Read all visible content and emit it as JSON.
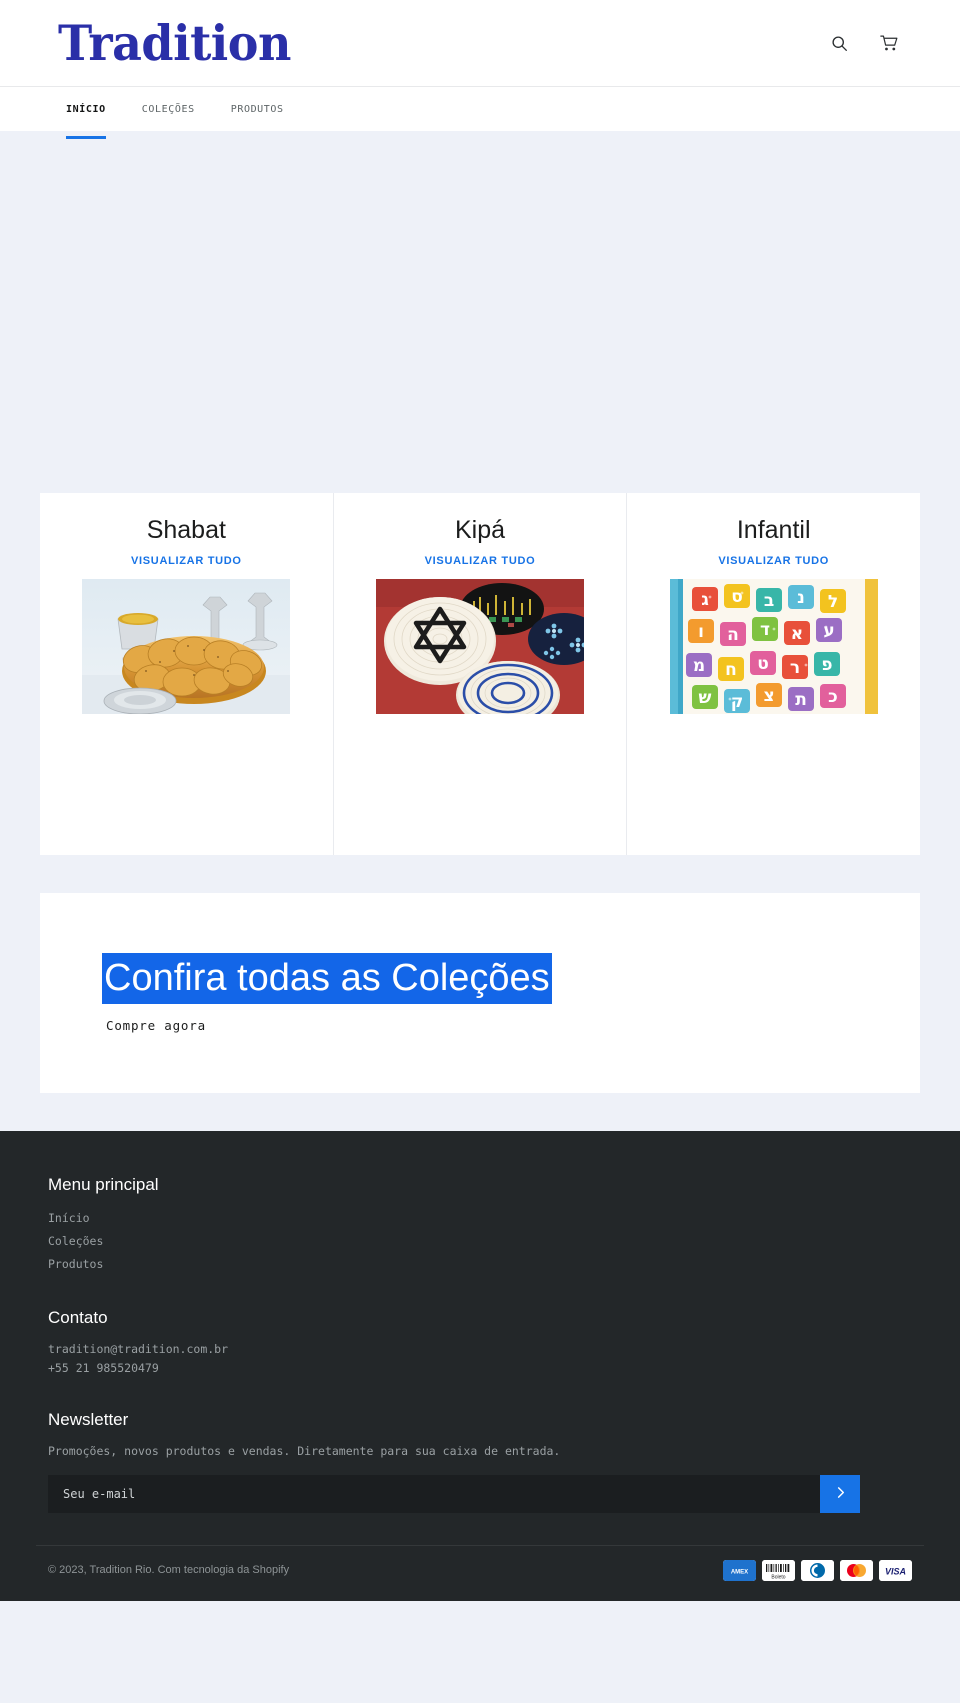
{
  "site": {
    "logo_text": "Tradition"
  },
  "header": {
    "search_icon": "search-icon",
    "cart_icon": "shopping-cart-icon"
  },
  "nav": {
    "items": [
      {
        "label": "INÍCIO",
        "active": true
      },
      {
        "label": "COLEÇÕES",
        "active": false
      },
      {
        "label": "PRODUTOS",
        "active": false
      }
    ]
  },
  "collections": {
    "view_all_label": "VISUALIZAR TUDO",
    "items": [
      {
        "title": "Shabat",
        "image": "challah-bread-kiddush-cup-photo"
      },
      {
        "title": "Kipá",
        "image": "knitted-kippot-photo"
      },
      {
        "title": "Infantil",
        "image": "hebrew-letter-magnets-photo"
      }
    ]
  },
  "promo": {
    "title": "Confira todas as Coleções",
    "button_label": "Compre agora",
    "highlight_color": "#1366e8"
  },
  "footer": {
    "menu": {
      "heading": "Menu principal",
      "items": [
        {
          "label": "Início"
        },
        {
          "label": "Coleções"
        },
        {
          "label": "Produtos"
        }
      ]
    },
    "contact": {
      "heading": "Contato",
      "email": "tradition@tradition.com.br",
      "phone": "+55 21 985520479"
    },
    "newsletter": {
      "heading": "Newsletter",
      "description": "Promoções, novos produtos e vendas. Diretamente para sua caixa de entrada.",
      "placeholder": "Seu e-mail",
      "value": "",
      "submit_icon": "chevron-right-icon",
      "submit_color": "#1773e6"
    },
    "copyright": "© 2023, Tradition Rio. Com tecnologia da Shopify",
    "payment_methods": [
      {
        "name": "American Express",
        "label": "AMEX"
      },
      {
        "name": "Boleto",
        "label": "Boleto"
      },
      {
        "name": "Diners Club",
        "label": "Diners"
      },
      {
        "name": "Mastercard",
        "label": "Mastercard"
      },
      {
        "name": "Visa",
        "label": "VISA"
      }
    ]
  }
}
